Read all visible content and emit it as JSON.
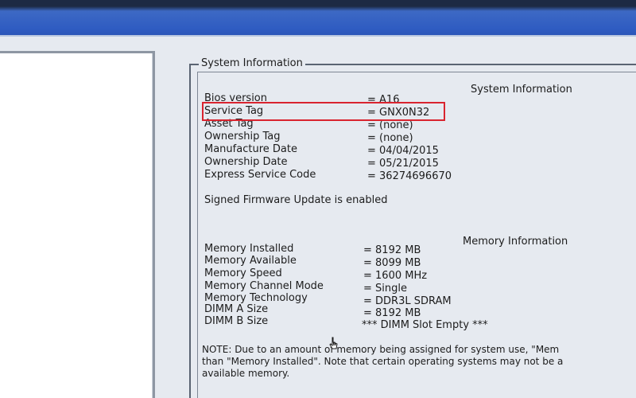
{
  "group_title": "System Information",
  "system_info": {
    "heading": "System Information",
    "rows": [
      {
        "label": "Bios version",
        "value": "= A16"
      },
      {
        "label": "Service Tag",
        "value": "= GNX0N32"
      },
      {
        "label": "Asset Tag",
        "value": "= (none)"
      },
      {
        "label": "Ownership Tag",
        "value": "= (none)"
      },
      {
        "label": "Manufacture Date",
        "value": "= 04/04/2015"
      },
      {
        "label": "Ownership Date",
        "value": "= 05/21/2015"
      },
      {
        "label": "Express Service Code",
        "value": "= 36274696670"
      }
    ],
    "status": "Signed Firmware Update is enabled"
  },
  "memory_info": {
    "heading": "Memory Information",
    "rows": [
      {
        "label": "Memory Installed",
        "value": "= 8192 MB"
      },
      {
        "label": "Memory Available",
        "value": "= 8099 MB"
      },
      {
        "label": "Memory Speed",
        "value": "= 1600 MHz"
      },
      {
        "label": "Memory Channel Mode",
        "value": "= Single"
      },
      {
        "label": "Memory Technology",
        "value": "= DDR3L SDRAM"
      },
      {
        "label": "DIMM A Size",
        "value": "= 8192 MB"
      },
      {
        "label": "DIMM B Size",
        "value": "*** DIMM Slot Empty ***"
      }
    ]
  },
  "note": {
    "line1": "NOTE: Due to an amount of memory being assigned for system use, \"Mem",
    "line2": "than \"Memory Installed\". Note that certain operating systems may not be a",
    "line3": "available memory."
  },
  "colors": {
    "highlight": "#d9242f",
    "title_bar": "#2f5cc2",
    "panel_background": "#e6eaf0"
  },
  "icons": [
    "mouse-cursor-icon"
  ]
}
